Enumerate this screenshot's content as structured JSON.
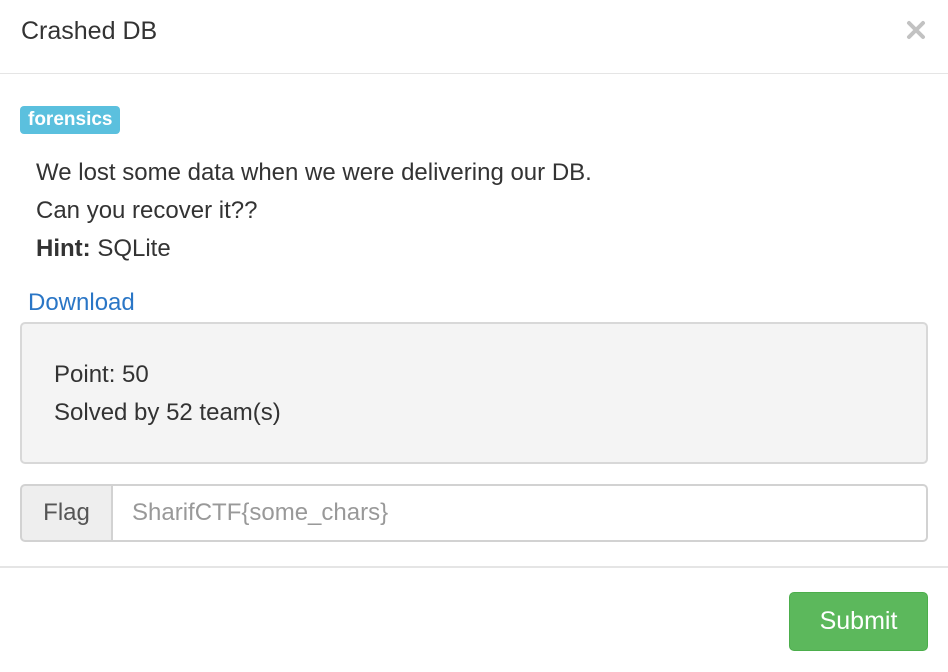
{
  "modal": {
    "title": "Crashed DB",
    "close_icon": "close-icon"
  },
  "challenge": {
    "category": "forensics",
    "description_lines": [
      "We lost some data when we were delivering our DB.",
      "Can you recover it??"
    ],
    "hint_label": "Hint:",
    "hint_value": " SQLite",
    "download_label": "Download",
    "points_text": "Point: 50",
    "solved_text": "Solved by 52 team(s)"
  },
  "flag_form": {
    "addon_label": "Flag",
    "input_value": "",
    "input_placeholder": "SharifCTF{some_chars}",
    "submit_label": "Submit"
  },
  "colors": {
    "tag_bg": "#5bc0de",
    "link": "#2a76c6",
    "submit_bg": "#5cb85c",
    "well_bg": "#f4f4f4"
  }
}
